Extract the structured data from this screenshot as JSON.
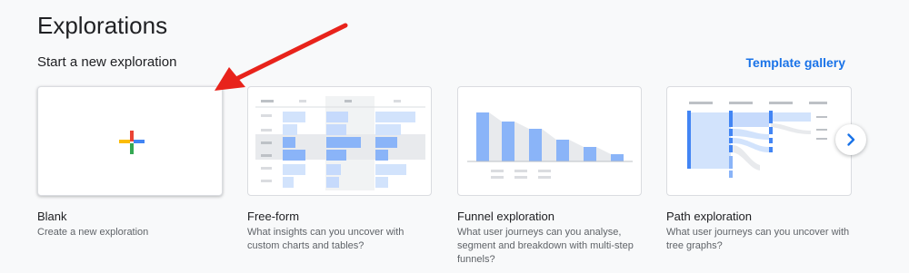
{
  "header": {
    "title": "Explorations"
  },
  "section": {
    "title": "Start a new exploration",
    "template_link": "Template gallery"
  },
  "cards": [
    {
      "title": "Blank",
      "description": "Create a new exploration"
    },
    {
      "title": "Free-form",
      "description": "What insights can you uncover with custom charts and tables?"
    },
    {
      "title": "Funnel exploration",
      "description": "What user journeys can you analyse, segment and breakdown with multi-step funnels?"
    },
    {
      "title": "Path exploration",
      "description": "What user journeys can you uncover with tree graphs?"
    }
  ],
  "colors": {
    "accent": "#1a73e8",
    "annotation_arrow": "#e8231b",
    "chart_blue": "#8ab4f8"
  },
  "icons": [
    "plus-icon",
    "chevron-right-icon",
    "arrow-annotation"
  ]
}
